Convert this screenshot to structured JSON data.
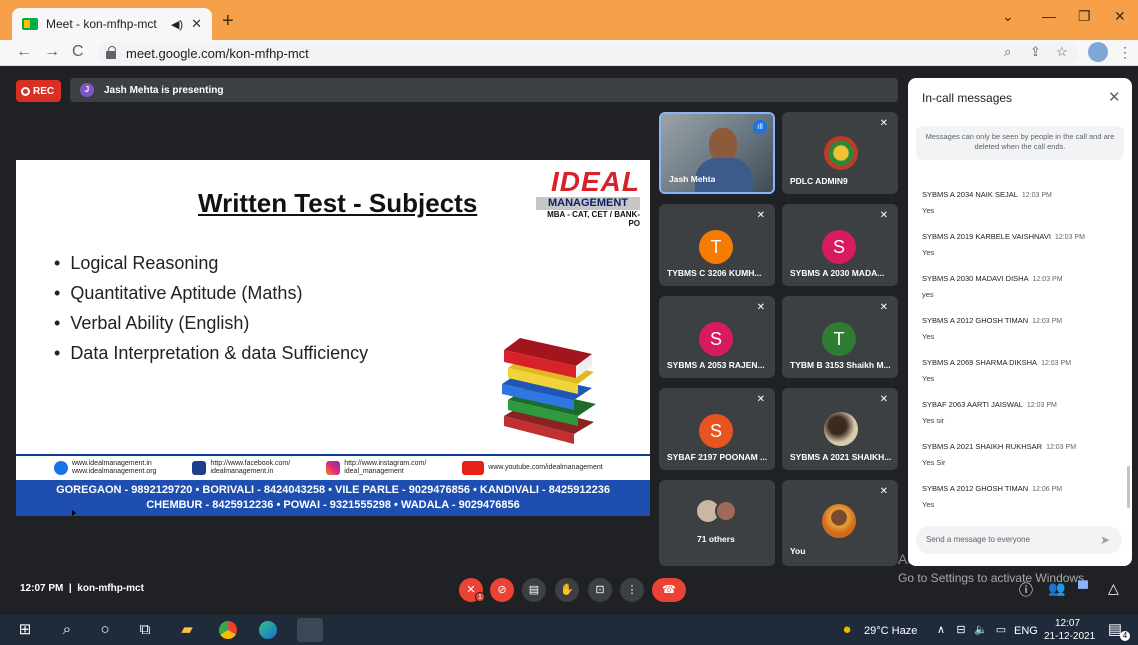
{
  "browser": {
    "tab_title": "Meet - kon-mfhp-mct",
    "url": "meet.google.com/kon-mfhp-mct"
  },
  "meet": {
    "rec_label": "REC",
    "presenter_initial": "J",
    "presenting_text": "Jash Mehta is presenting",
    "meeting_time": "12:07 PM",
    "meeting_code": "kon-mfhp-mct",
    "mic_badge": "1"
  },
  "slide": {
    "title": "Written Test - Subjects",
    "logo_main": "IDEAL",
    "logo_sub": "MANAGEMENT",
    "logo_tag": "MBA - CAT, CET / BANK-PO",
    "bullets": [
      "Logical Reasoning",
      "Quantitative Aptitude (Maths)",
      "Verbal Ability (English)",
      "Data Interpretation & data Sufficiency"
    ],
    "footer_links": [
      {
        "line1": "www.idealmanagement.in",
        "line2": "www.idealmanagement.org"
      },
      {
        "line1": "http://www.facebook.com/",
        "line2": "idealmanagement.in"
      },
      {
        "line1": "http://www.instagram.com/",
        "line2": "ideal_management"
      },
      {
        "line1": "www.youtube.com/idealmanagement",
        "line2": ""
      }
    ],
    "footer_line1": "GOREGAON - 9892129720 • BORIVALI - 8424043258 • VILE PARLE - 9029476856 • KANDIVALI - 8425912236",
    "footer_line2": "CHEMBUR - 8425912236 • POWAI - 9321555298 • WADALA - 9029476856"
  },
  "tiles": [
    {
      "name": "Jash Mehta"
    },
    {
      "name": "PDLC ADMIN9"
    },
    {
      "name": "TYBMS C 3206 KUMH...",
      "initial": "T"
    },
    {
      "name": "SYBMS A 2030 MADA...",
      "initial": "S"
    },
    {
      "name": "SYBMS A 2053 RAJEN...",
      "initial": "S"
    },
    {
      "name": "TYBM B 3153 Shaikh M...",
      "initial": "T"
    },
    {
      "name": "SYBAF 2197 POONAM ...",
      "initial": "S"
    },
    {
      "name": "SYBMS A 2021 SHAIKH..."
    },
    {
      "name": "71 others"
    },
    {
      "name": "You"
    }
  ],
  "chat": {
    "title": "In-call messages",
    "note": "Messages can only be seen by people in the call and are deleted when the call ends.",
    "messages": [
      {
        "sender": "SYBMS A 2034 NAIK SEJAL",
        "time": "12:03 PM",
        "text": "Yes"
      },
      {
        "sender": "SYBMS A 2019 KARBELE VAISHNAVI",
        "time": "12:03 PM",
        "text": "Yes"
      },
      {
        "sender": "SYBMS A 2030 MADAVI DISHA",
        "time": "12:03 PM",
        "text": "yes"
      },
      {
        "sender": "SYBMS A 2012 GHOSH TIMAN",
        "time": "12:03 PM",
        "text": "Yes"
      },
      {
        "sender": "SYBMS A 2069 SHARMA DIKSHA",
        "time": "12:03 PM",
        "text": "Yes"
      },
      {
        "sender": "SYBAF 2063 AARTI JAISWAL",
        "time": "12:03 PM",
        "text": "Yes sir"
      },
      {
        "sender": "SYBMS A 2021 SHAIKH RUKHSAR",
        "time": "12:03 PM",
        "text": "Yes Sir"
      },
      {
        "sender": "SYBMS A 2012 GHOSH TIMAN",
        "time": "12:06 PM",
        "text": "Yes"
      }
    ],
    "input_placeholder": "Send a message to everyone"
  },
  "watermark": {
    "line1": "Activate Windows",
    "line2": "Go to Settings to activate Windows."
  },
  "taskbar": {
    "weather": "29°C  Haze",
    "lang": "ENG",
    "time": "12:07",
    "date": "21-12-2021",
    "notif_count": "4"
  },
  "colors": {
    "tab_bar": "#f6a14a",
    "meet_bg": "#202124",
    "tile_bg": "#3c4043",
    "rec_red": "#d93025",
    "slide_footer_blue": "#1e4fb0"
  }
}
